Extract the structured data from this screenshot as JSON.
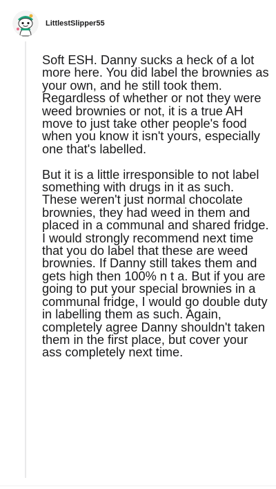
{
  "comment": {
    "username": "LittlestSlipper55",
    "avatar_icon": "snoo-avatar-icon",
    "paragraphs": [
      "Soft ESH. Danny sucks a heck of a lot more here. You did label the brownies as your own, and he still took them. Regardless of whether or not they were weed brownies or not, it is a true AH move to just take other people's food when you know it isn't yours, especially one that's labelled.",
      "But it is a little irresponsible to not label something with drugs in it as such. These weren't just normal chocolate brownies, they had weed in them and placed in a communal and shared fridge. I would strongly recommend next time that you do label that these are weed brownies. If Danny still takes them and gets high then 100% n t a. But if you are going to put your special brownies in a communal fridge, I would go double duty in labelling them as such. Again, completely agree Danny shouldn't taken them in the first place, but cover your ass completely next time."
    ]
  },
  "colors": {
    "text": "#1a1a1b",
    "thread_line": "#e9e9ea",
    "avatar_bg": "#f4f4f4",
    "avatar_accent": "#1fa37a"
  }
}
